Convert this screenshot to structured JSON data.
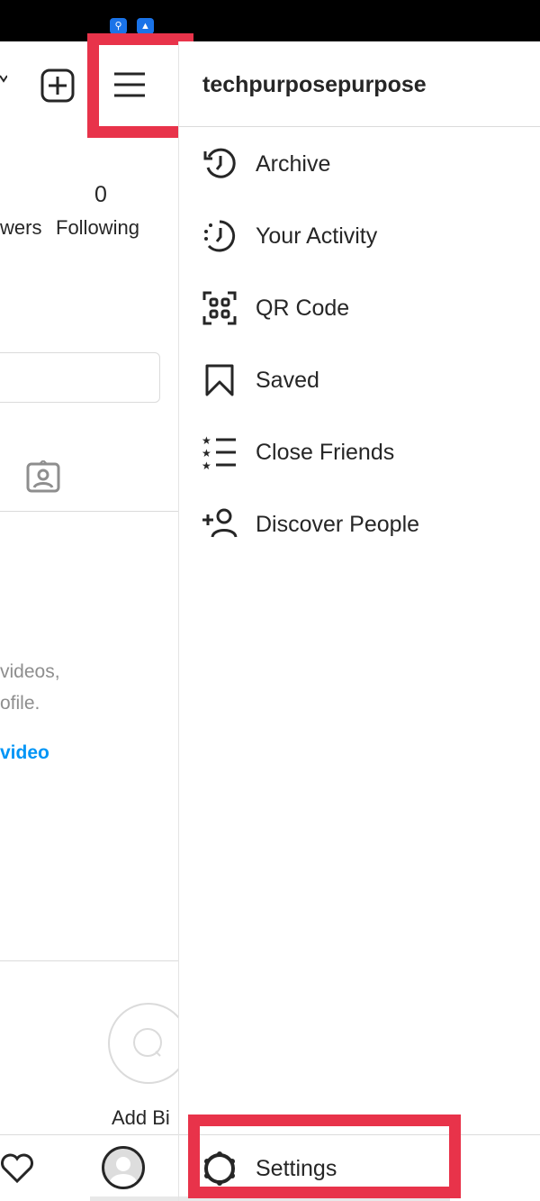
{
  "status_bar": {
    "icons": [
      "usb-icon",
      "android-icon"
    ]
  },
  "profile": {
    "following_count": "0",
    "followers_label_partial": "wers",
    "following_label": "Following",
    "empty_text_line1": "videos,",
    "empty_text_line2": "ofile.",
    "empty_link": "video",
    "add_bio_label": "Add Bi"
  },
  "drawer": {
    "username": "techpurposepurpose",
    "items": [
      {
        "label": "Archive",
        "icon": "archive-icon"
      },
      {
        "label": "Your Activity",
        "icon": "activity-icon"
      },
      {
        "label": "QR Code",
        "icon": "qr-code-icon"
      },
      {
        "label": "Saved",
        "icon": "bookmark-icon"
      },
      {
        "label": "Close Friends",
        "icon": "close-friends-icon"
      },
      {
        "label": "Discover People",
        "icon": "add-person-icon"
      }
    ],
    "settings_label": "Settings"
  },
  "colors": {
    "highlight": "#e8334a",
    "link": "#0095f6"
  }
}
